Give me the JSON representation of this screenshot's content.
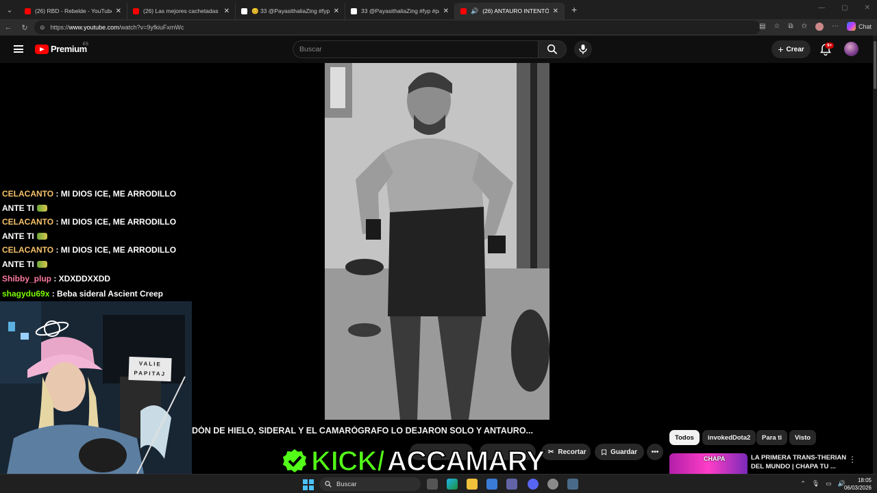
{
  "browser": {
    "tabs": [
      {
        "title": "(26) RBD - Rebelde - YouTube",
        "favicon_color": "#ff0000",
        "active": false
      },
      {
        "title": "(26) Las mejores cachetadas de Ar",
        "favicon_color": "#ff0000",
        "active": false
      },
      {
        "title": "😊 33 @PayasithaliaZing #fyp #pa",
        "favicon_color": "#ffffff",
        "active": false
      },
      {
        "title": "33 @PayasithaliaZing #fyp #pa",
        "favicon_color": "#ffffff",
        "active": false
      },
      {
        "title": "(26) ANTAURO INTENTÓ ENF",
        "favicon_color": "#ff0000",
        "active": true
      }
    ],
    "url_prefix": "https://",
    "url_host": "www.youtube.com",
    "url_path": "/watch?v=9yfkiuFxmWc",
    "chat_label": "Chat"
  },
  "youtube": {
    "logo_text": "Premium",
    "region_code": "ES",
    "search_placeholder": "Buscar",
    "create_label": "Crear",
    "notification_badge": "9+",
    "video_title": "DÓN DE HIELO, SIDERAL Y EL CAMARÓGRAFO LO DEJARON SOLO Y ANTAURO...",
    "actions": {
      "clip_label": "Recortar",
      "save_label": "Guardar"
    },
    "chips": [
      "Todos",
      "invokedDota2",
      "Para ti",
      "Visto"
    ],
    "recommended": {
      "title": "LA PRIMERA TRANS-THERIAN DEL MUNDO | CHAPA TU ...",
      "thumb_text": "CHAPA"
    }
  },
  "chat": [
    {
      "user": "CELACANTO",
      "user_color": "#f5c26b",
      "text": ": MI DIOS ICE, ME ARRODILLO",
      "cont": "ANTE TI"
    },
    {
      "user": "CELACANTO",
      "user_color": "#f5c26b",
      "text": ": MI DIOS ICE, ME ARRODILLO",
      "cont": "ANTE TI"
    },
    {
      "user": "CELACANTO",
      "user_color": "#f5c26b",
      "text": ": MI DIOS ICE, ME ARRODILLO",
      "cont": "ANTE TI"
    },
    {
      "user": "Shibby_plup",
      "user_color": "#ff7aa0",
      "text": ": XDXDDXXDD",
      "cont": ""
    },
    {
      "user": "shagydu69x",
      "user_color": "#7cfc00",
      "text": ": Beba sideral Ascient Creep",
      "cont": ""
    }
  ],
  "webcam": {
    "sign_line1": "VALIE",
    "sign_line2": "PAPITAJ"
  },
  "overlay": {
    "kick_part1": "KICK/",
    "kick_part2": "ACCAMARY"
  },
  "taskbar": {
    "search_placeholder": "Buscar",
    "time": "18:05",
    "date": "06/03/2026"
  }
}
